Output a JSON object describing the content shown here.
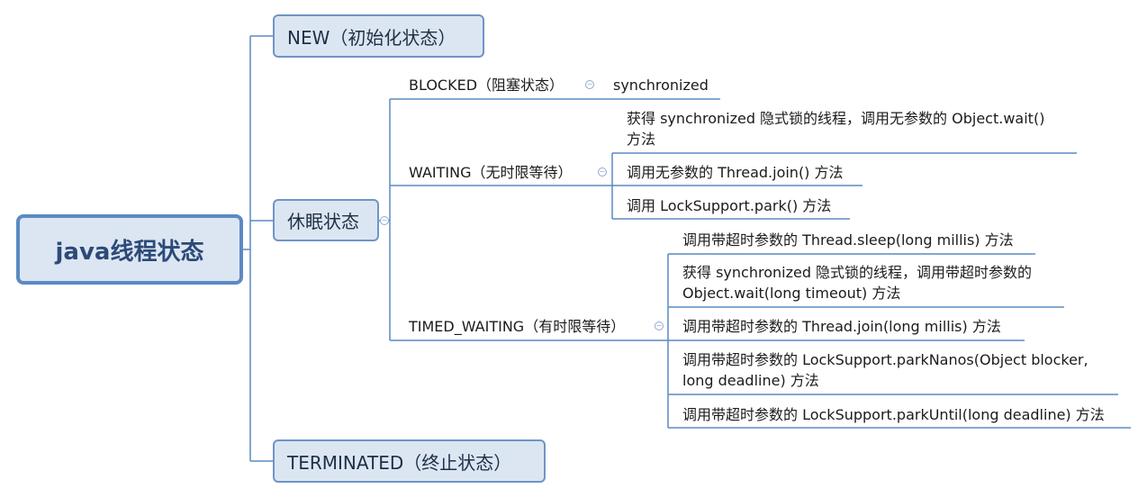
{
  "root": "java线程状态",
  "level1": {
    "new": "NEW（初始化状态）",
    "sleep": "休眠状态",
    "terminated": "TERMINATED（终止状态）"
  },
  "level2": {
    "blocked": "BLOCKED（阻塞状态）",
    "waiting": "WAITING（无时限等待）",
    "timed_waiting": "TIMED_WAITING（有时限等待）"
  },
  "blocked_items": [
    "synchronized"
  ],
  "waiting_items": [
    [
      "获得 synchronized 隐式锁的线程，调用无参数的 Object.wait()",
      "方法"
    ],
    [
      "调用无参数的 Thread.join() 方法"
    ],
    [
      "调用 LockSupport.park() 方法"
    ]
  ],
  "timed_waiting_items": [
    [
      "调用带超时参数的 Thread.sleep(long millis) 方法"
    ],
    [
      "获得 synchronized 隐式锁的线程，调用带超时参数的",
      "Object.wait(long timeout) 方法"
    ],
    [
      "调用带超时参数的 Thread.join(long millis) 方法"
    ],
    [
      "调用带超时参数的 LockSupport.parkNanos(Object blocker,",
      "long deadline) 方法"
    ],
    [
      "调用带超时参数的 LockSupport.parkUntil(long deadline) 方法"
    ]
  ],
  "colors": {
    "line": "#5b8ac3",
    "fill": "#dce6f2",
    "border": "#6e95c7"
  }
}
